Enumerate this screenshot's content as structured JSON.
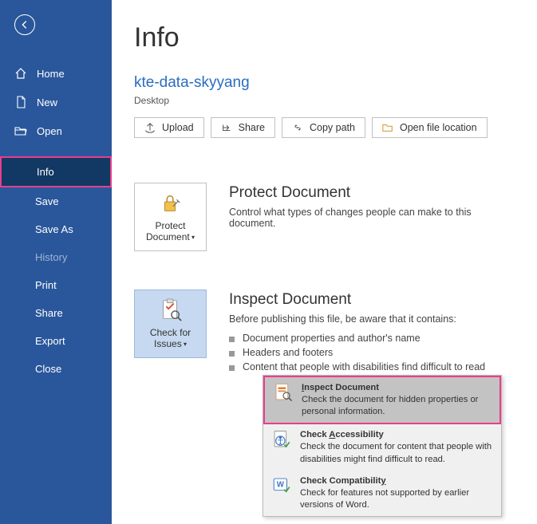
{
  "sidebar": {
    "items": [
      {
        "label": "Home"
      },
      {
        "label": "New"
      },
      {
        "label": "Open"
      },
      {
        "label": "Info"
      },
      {
        "label": "Save"
      },
      {
        "label": "Save As"
      },
      {
        "label": "History"
      },
      {
        "label": "Print"
      },
      {
        "label": "Share"
      },
      {
        "label": "Export"
      },
      {
        "label": "Close"
      }
    ]
  },
  "main": {
    "title": "Info",
    "doc_name": "kte-data-skyyang",
    "doc_location": "Desktop",
    "actions": {
      "upload": "Upload",
      "share": "Share",
      "copy_path": "Copy path",
      "open_location": "Open file location"
    },
    "protect": {
      "btn_label": "Protect Document",
      "title": "Protect Document",
      "desc": "Control what types of changes people can make to this document."
    },
    "inspect": {
      "btn_label": "Check for Issues",
      "title": "Inspect Document",
      "desc": "Before publishing this file, be aware that it contains:",
      "bullets": [
        "Document properties and author's name",
        "Headers and footers",
        "Content that people with disabilities find difficult to read"
      ]
    },
    "dropdown": {
      "items": [
        {
          "title_pre": "",
          "title_u": "I",
          "title_post": "nspect Document",
          "desc": "Check the document for hidden properties or personal information."
        },
        {
          "title_pre": "Check ",
          "title_u": "A",
          "title_post": "ccessibility",
          "desc": "Check the document for content that people with disabilities might find difficult to read."
        },
        {
          "title_pre": "Check Compatibilit",
          "title_u": "y",
          "title_post": "",
          "desc": "Check for features not supported by earlier versions of Word."
        }
      ]
    }
  }
}
